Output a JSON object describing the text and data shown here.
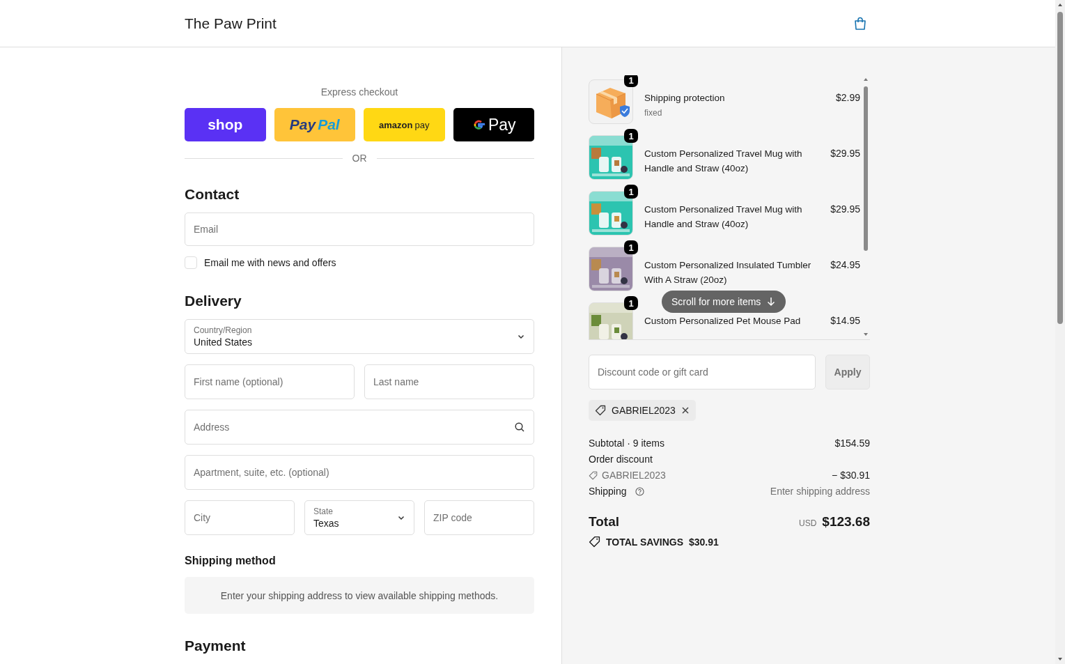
{
  "header": {
    "store_name": "The Paw Print"
  },
  "express_checkout": {
    "label": "Express checkout",
    "divider": "OR",
    "buttons": [
      {
        "kind": "shop",
        "parts": [
          "shop"
        ]
      },
      {
        "kind": "paypal",
        "parts": [
          "Pay",
          "Pal"
        ]
      },
      {
        "kind": "amazon",
        "parts": [
          "amazon",
          "pay"
        ]
      },
      {
        "kind": "gpay",
        "parts": [
          "Pay"
        ]
      }
    ]
  },
  "contact": {
    "heading": "Contact",
    "email_placeholder": "Email",
    "newsletter": {
      "label": "Email me with news and offers",
      "checked": false
    }
  },
  "delivery": {
    "heading": "Delivery",
    "rows": [
      [
        {
          "kind": "select",
          "label": "Country/Region",
          "value": "United States"
        }
      ],
      [
        {
          "kind": "text",
          "placeholder": "First name (optional)"
        },
        {
          "kind": "text",
          "placeholder": "Last name"
        }
      ],
      [
        {
          "kind": "search",
          "placeholder": "Address"
        }
      ],
      [
        {
          "kind": "text",
          "placeholder": "Apartment, suite, etc. (optional)"
        }
      ],
      [
        {
          "kind": "text",
          "placeholder": "City"
        },
        {
          "kind": "select",
          "label": "State",
          "value": "Texas"
        },
        {
          "kind": "text",
          "placeholder": "ZIP code"
        }
      ]
    ]
  },
  "shipping_method": {
    "heading": "Shipping method",
    "notice": "Enter your shipping address to view available shipping methods."
  },
  "payment": {
    "heading": "Payment"
  },
  "order_summary": {
    "items": [
      {
        "kind": "package",
        "name": "Shipping protection",
        "variant": "fixed",
        "price": "$2.99",
        "quantity": "1"
      },
      {
        "kind": "picture",
        "name": "Custom Personalized Travel Mug with Handle and Straw (40oz)",
        "price": "$29.95",
        "quantity": "1"
      },
      {
        "kind": "picture",
        "name": "Custom Personalized Travel Mug with Handle and Straw (40oz)",
        "price": "$29.95",
        "quantity": "1"
      },
      {
        "kind": "picture",
        "name": "Custom Personalized Insulated Tumbler With A Straw (20oz)",
        "price": "$24.95",
        "quantity": "1"
      },
      {
        "kind": "picture",
        "name": "Custom Personalized Pet Mouse Pad",
        "price": "$14.95",
        "quantity": "1"
      }
    ],
    "scroll_hint": "Scroll for more items",
    "discount": {
      "placeholder": "Discount code or gift card",
      "apply_label": "Apply",
      "apply_disabled": true
    },
    "applied_code": "GABRIEL2023",
    "subtotal": {
      "label": "Subtotal · 9 items",
      "value": "$154.59"
    },
    "order_discount": {
      "label": "Order discount",
      "code": "GABRIEL2023",
      "value": "− $30.91"
    },
    "shipping": {
      "label": "Shipping",
      "value": "Enter shipping address"
    },
    "total": {
      "label": "Total",
      "currency": "USD",
      "value": "$123.68"
    },
    "savings": {
      "label": "TOTAL SAVINGS",
      "value": "$30.91"
    }
  }
}
